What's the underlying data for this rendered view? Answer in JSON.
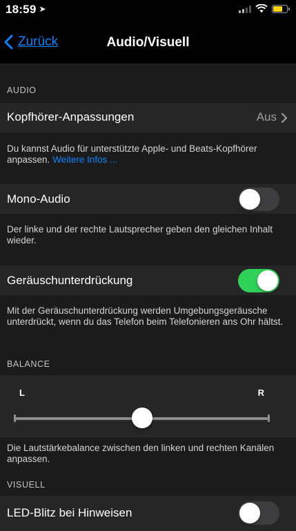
{
  "status_bar": {
    "time": "18:59",
    "location_arrow": "location-arrow-icon",
    "battery_color": "#ffd60a"
  },
  "nav": {
    "back_label": "Zurück",
    "title": "Audio/Visuell",
    "accent_color": "#0a84ff"
  },
  "audio_section": {
    "header": "AUDIO",
    "headphones": {
      "label": "Kopfhörer-Anpassungen",
      "value": "Aus"
    },
    "headphones_footer": {
      "text": "Du kannst Audio für unterstützte Apple- und Beats-Kopfhörer anpassen. ",
      "link": "Weitere Infos ..."
    },
    "mono": {
      "label": "Mono-Audio",
      "enabled": false
    },
    "mono_footer": "Der linke und der rechte Lautsprecher geben den gleichen Inhalt wieder.",
    "noise": {
      "label": "Geräuschunterdrückung",
      "enabled": true,
      "on_color": "#30d158"
    },
    "noise_footer": "Mit der Geräuschunterdrückung werden Umgebungsgeräusche unterdrückt, wenn du das Telefon beim Telefonieren ans Ohr hältst."
  },
  "balance_section": {
    "header": "BALANCE",
    "left_label": "L",
    "right_label": "R",
    "balance_value": 0.5,
    "footer": "Die Lautstärkebalance zwischen den linken und rechten Kanälen anpassen."
  },
  "visual_section": {
    "header": "VISUELL",
    "led": {
      "label": "LED-Blitz bei Hinweisen",
      "enabled": false
    }
  }
}
